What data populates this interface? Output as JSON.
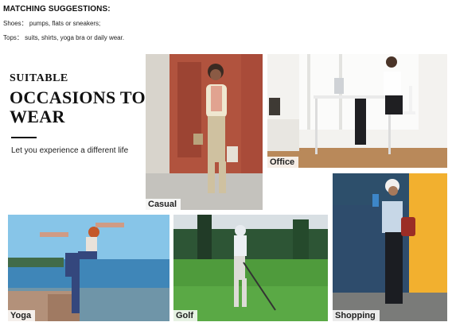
{
  "suggestions": {
    "heading": "MATCHING SUGGESTIONS:",
    "shoes": "Shoes： pumps, flats or sneakers;",
    "tops": "Tops： suits, shirts, yoga bra or daily wear."
  },
  "occasions_block": {
    "suitable": "SUITABLE",
    "title_line1": "OCCASIONS TO",
    "title_line2": "WEAR",
    "tagline": "Let you experience a different life"
  },
  "photos": {
    "casual": "Casual",
    "office": "Office",
    "shopping": "Shopping",
    "yoga": "Yoga",
    "golf": "Golf"
  }
}
